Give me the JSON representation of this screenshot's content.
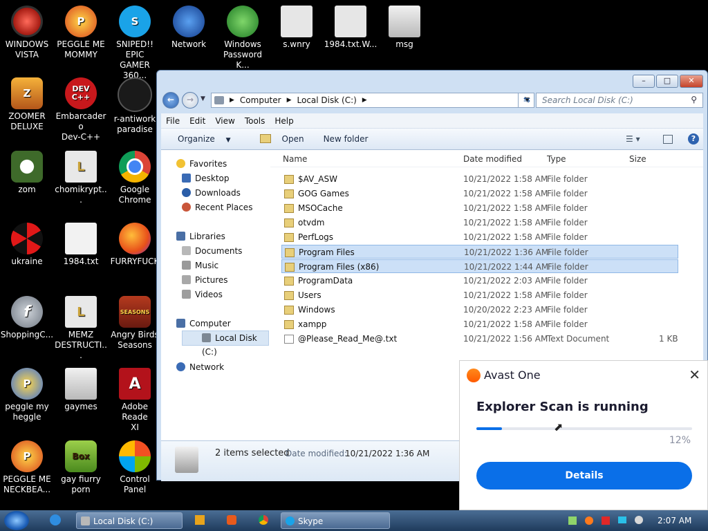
{
  "desktop": {
    "icons": [
      {
        "label": "WINDOWS\nVISTA",
        "icon": "vista-icon"
      },
      {
        "label": "PEGGLE ME\nMOMMY",
        "icon": "peggle-icon"
      },
      {
        "label": "SNIPED!! EPIC\nGAMER 360...",
        "icon": "skype-icon"
      },
      {
        "label": "Network",
        "icon": "network-icon"
      },
      {
        "label": "Windows\nPassword K...",
        "icon": "password-icon"
      },
      {
        "label": "s.wnry",
        "icon": "file-icon"
      },
      {
        "label": "1984.txt.W...",
        "icon": "file-icon"
      },
      {
        "label": "msg",
        "icon": "folder-icon"
      },
      {
        "label": "ZOOMER\nDELUXE",
        "icon": "zoomer-icon"
      },
      {
        "label": "Embarcadero\nDev-C++",
        "icon": "devcpp-icon",
        "badge": "DEV\nC++"
      },
      {
        "label": "r-antiwork\nparadise",
        "icon": "reddit-icon"
      },
      {
        "label": "zom",
        "icon": "flower-icon"
      },
      {
        "label": "chomikrypt...",
        "icon": "lock-file-icon"
      },
      {
        "label": "Google\nChrome",
        "icon": "chrome-icon"
      },
      {
        "label": "ukraine",
        "icon": "radiation-icon"
      },
      {
        "label": "1984.txt",
        "icon": "text-file-icon"
      },
      {
        "label": "FURRYFUCK",
        "icon": "firefox-icon"
      },
      {
        "label": "ShoppingC...",
        "icon": "flash-icon"
      },
      {
        "label": "MEMZ\nDESTRUCTI...",
        "icon": "lock-file-icon"
      },
      {
        "label": "Angry Birds\nSeasons",
        "icon": "angry-birds-icon",
        "badge": "SEASONS"
      },
      {
        "label": "peggle my\nheggle",
        "icon": "peggle-icon"
      },
      {
        "label": "gaymes",
        "icon": "folder-icon"
      },
      {
        "label": "Adobe Reade\nXI",
        "icon": "adobe-reader-icon"
      },
      {
        "label": "PEGGLE ME\nNECKBEA...",
        "icon": "peggle-icon"
      },
      {
        "label": "gay fiurry\nporn",
        "icon": "box-icon",
        "badge": "Box"
      },
      {
        "label": "Control Panel",
        "icon": "control-panel-icon"
      }
    ]
  },
  "explorer": {
    "breadcrumb": [
      "Computer",
      "Local Disk (C:)"
    ],
    "search_placeholder": "Search Local Disk (C:)",
    "menu": [
      "File",
      "Edit",
      "View",
      "Tools",
      "Help"
    ],
    "toolbar": {
      "organize": "Organize",
      "open": "Open",
      "new_folder": "New folder"
    },
    "nav": {
      "favorites": "Favorites",
      "desktop": "Desktop",
      "downloads": "Downloads",
      "recent": "Recent Places",
      "libraries": "Libraries",
      "documents": "Documents",
      "music": "Music",
      "pictures": "Pictures",
      "videos": "Videos",
      "computer": "Computer",
      "local_disk": "Local Disk (C:)",
      "network": "Network"
    },
    "columns": {
      "name": "Name",
      "date": "Date modified",
      "type": "Type",
      "size": "Size"
    },
    "files": [
      {
        "name": "$AV_ASW",
        "date": "10/21/2022 1:58 AM",
        "type": "File folder",
        "size": ""
      },
      {
        "name": "GOG Games",
        "date": "10/21/2022 1:58 AM",
        "type": "File folder",
        "size": ""
      },
      {
        "name": "MSOCache",
        "date": "10/21/2022 1:58 AM",
        "type": "File folder",
        "size": ""
      },
      {
        "name": "otvdm",
        "date": "10/21/2022 1:58 AM",
        "type": "File folder",
        "size": ""
      },
      {
        "name": "PerfLogs",
        "date": "10/21/2022 1:58 AM",
        "type": "File folder",
        "size": ""
      },
      {
        "name": "Program Files",
        "date": "10/21/2022 1:36 AM",
        "type": "File folder",
        "size": ""
      },
      {
        "name": "Program Files (x86)",
        "date": "10/21/2022 1:44 AM",
        "type": "File folder",
        "size": ""
      },
      {
        "name": "ProgramData",
        "date": "10/21/2022 2:03 AM",
        "type": "File folder",
        "size": ""
      },
      {
        "name": "Users",
        "date": "10/21/2022 1:58 AM",
        "type": "File folder",
        "size": ""
      },
      {
        "name": "Windows",
        "date": "10/20/2022 2:23 AM",
        "type": "File folder",
        "size": ""
      },
      {
        "name": "xampp",
        "date": "10/21/2022 1:58 AM",
        "type": "File folder",
        "size": ""
      },
      {
        "name": "@Please_Read_Me@.txt",
        "date": "10/21/2022 1:56 AM",
        "type": "Text Document",
        "size": "1 KB"
      }
    ],
    "status": {
      "selected": "2 items selected",
      "modified_label": "Date modified:",
      "modified_value": "10/21/2022 1:36 AM"
    }
  },
  "avast": {
    "brand": "Avast One",
    "title": "Explorer Scan is running",
    "progress": 12,
    "progress_text": "12%",
    "button": "Details",
    "accent": "#0a6fe8"
  },
  "taskbar": {
    "windows": [
      "Local Disk (C:)",
      "Skype"
    ],
    "clock": "2:07 AM"
  }
}
